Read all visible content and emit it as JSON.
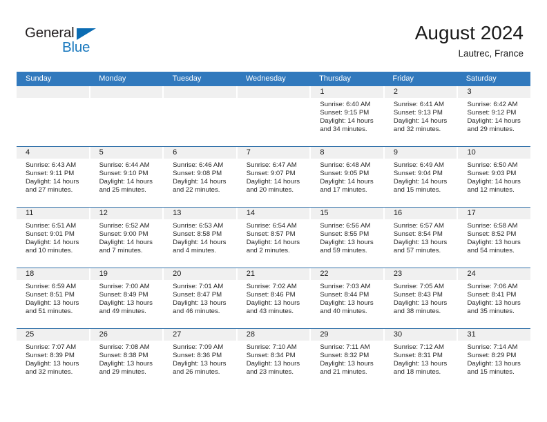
{
  "brand": {
    "name_part1": "General",
    "name_part2": "Blue",
    "triangle_color": "#0b6cb3",
    "blue_color": "#1878be"
  },
  "header": {
    "title": "August 2024",
    "subtitle": "Lautrec, France"
  },
  "theme": {
    "header_blue": "#3179bd",
    "row_divider": "#2f6fa8",
    "day_band": "#f0f0f0",
    "text": "#1a1a1a"
  },
  "weekdays": [
    "Sunday",
    "Monday",
    "Tuesday",
    "Wednesday",
    "Thursday",
    "Friday",
    "Saturday"
  ],
  "weeks": [
    [
      {
        "day": "",
        "sunrise": "",
        "sunset": "",
        "daylight_line1": "",
        "daylight_line2": ""
      },
      {
        "day": "",
        "sunrise": "",
        "sunset": "",
        "daylight_line1": "",
        "daylight_line2": ""
      },
      {
        "day": "",
        "sunrise": "",
        "sunset": "",
        "daylight_line1": "",
        "daylight_line2": ""
      },
      {
        "day": "",
        "sunrise": "",
        "sunset": "",
        "daylight_line1": "",
        "daylight_line2": ""
      },
      {
        "day": "1",
        "sunrise": "Sunrise: 6:40 AM",
        "sunset": "Sunset: 9:15 PM",
        "daylight_line1": "Daylight: 14 hours",
        "daylight_line2": "and 34 minutes."
      },
      {
        "day": "2",
        "sunrise": "Sunrise: 6:41 AM",
        "sunset": "Sunset: 9:13 PM",
        "daylight_line1": "Daylight: 14 hours",
        "daylight_line2": "and 32 minutes."
      },
      {
        "day": "3",
        "sunrise": "Sunrise: 6:42 AM",
        "sunset": "Sunset: 9:12 PM",
        "daylight_line1": "Daylight: 14 hours",
        "daylight_line2": "and 29 minutes."
      }
    ],
    [
      {
        "day": "4",
        "sunrise": "Sunrise: 6:43 AM",
        "sunset": "Sunset: 9:11 PM",
        "daylight_line1": "Daylight: 14 hours",
        "daylight_line2": "and 27 minutes."
      },
      {
        "day": "5",
        "sunrise": "Sunrise: 6:44 AM",
        "sunset": "Sunset: 9:10 PM",
        "daylight_line1": "Daylight: 14 hours",
        "daylight_line2": "and 25 minutes."
      },
      {
        "day": "6",
        "sunrise": "Sunrise: 6:46 AM",
        "sunset": "Sunset: 9:08 PM",
        "daylight_line1": "Daylight: 14 hours",
        "daylight_line2": "and 22 minutes."
      },
      {
        "day": "7",
        "sunrise": "Sunrise: 6:47 AM",
        "sunset": "Sunset: 9:07 PM",
        "daylight_line1": "Daylight: 14 hours",
        "daylight_line2": "and 20 minutes."
      },
      {
        "day": "8",
        "sunrise": "Sunrise: 6:48 AM",
        "sunset": "Sunset: 9:05 PM",
        "daylight_line1": "Daylight: 14 hours",
        "daylight_line2": "and 17 minutes."
      },
      {
        "day": "9",
        "sunrise": "Sunrise: 6:49 AM",
        "sunset": "Sunset: 9:04 PM",
        "daylight_line1": "Daylight: 14 hours",
        "daylight_line2": "and 15 minutes."
      },
      {
        "day": "10",
        "sunrise": "Sunrise: 6:50 AM",
        "sunset": "Sunset: 9:03 PM",
        "daylight_line1": "Daylight: 14 hours",
        "daylight_line2": "and 12 minutes."
      }
    ],
    [
      {
        "day": "11",
        "sunrise": "Sunrise: 6:51 AM",
        "sunset": "Sunset: 9:01 PM",
        "daylight_line1": "Daylight: 14 hours",
        "daylight_line2": "and 10 minutes."
      },
      {
        "day": "12",
        "sunrise": "Sunrise: 6:52 AM",
        "sunset": "Sunset: 9:00 PM",
        "daylight_line1": "Daylight: 14 hours",
        "daylight_line2": "and 7 minutes."
      },
      {
        "day": "13",
        "sunrise": "Sunrise: 6:53 AM",
        "sunset": "Sunset: 8:58 PM",
        "daylight_line1": "Daylight: 14 hours",
        "daylight_line2": "and 4 minutes."
      },
      {
        "day": "14",
        "sunrise": "Sunrise: 6:54 AM",
        "sunset": "Sunset: 8:57 PM",
        "daylight_line1": "Daylight: 14 hours",
        "daylight_line2": "and 2 minutes."
      },
      {
        "day": "15",
        "sunrise": "Sunrise: 6:56 AM",
        "sunset": "Sunset: 8:55 PM",
        "daylight_line1": "Daylight: 13 hours",
        "daylight_line2": "and 59 minutes."
      },
      {
        "day": "16",
        "sunrise": "Sunrise: 6:57 AM",
        "sunset": "Sunset: 8:54 PM",
        "daylight_line1": "Daylight: 13 hours",
        "daylight_line2": "and 57 minutes."
      },
      {
        "day": "17",
        "sunrise": "Sunrise: 6:58 AM",
        "sunset": "Sunset: 8:52 PM",
        "daylight_line1": "Daylight: 13 hours",
        "daylight_line2": "and 54 minutes."
      }
    ],
    [
      {
        "day": "18",
        "sunrise": "Sunrise: 6:59 AM",
        "sunset": "Sunset: 8:51 PM",
        "daylight_line1": "Daylight: 13 hours",
        "daylight_line2": "and 51 minutes."
      },
      {
        "day": "19",
        "sunrise": "Sunrise: 7:00 AM",
        "sunset": "Sunset: 8:49 PM",
        "daylight_line1": "Daylight: 13 hours",
        "daylight_line2": "and 49 minutes."
      },
      {
        "day": "20",
        "sunrise": "Sunrise: 7:01 AM",
        "sunset": "Sunset: 8:47 PM",
        "daylight_line1": "Daylight: 13 hours",
        "daylight_line2": "and 46 minutes."
      },
      {
        "day": "21",
        "sunrise": "Sunrise: 7:02 AM",
        "sunset": "Sunset: 8:46 PM",
        "daylight_line1": "Daylight: 13 hours",
        "daylight_line2": "and 43 minutes."
      },
      {
        "day": "22",
        "sunrise": "Sunrise: 7:03 AM",
        "sunset": "Sunset: 8:44 PM",
        "daylight_line1": "Daylight: 13 hours",
        "daylight_line2": "and 40 minutes."
      },
      {
        "day": "23",
        "sunrise": "Sunrise: 7:05 AM",
        "sunset": "Sunset: 8:43 PM",
        "daylight_line1": "Daylight: 13 hours",
        "daylight_line2": "and 38 minutes."
      },
      {
        "day": "24",
        "sunrise": "Sunrise: 7:06 AM",
        "sunset": "Sunset: 8:41 PM",
        "daylight_line1": "Daylight: 13 hours",
        "daylight_line2": "and 35 minutes."
      }
    ],
    [
      {
        "day": "25",
        "sunrise": "Sunrise: 7:07 AM",
        "sunset": "Sunset: 8:39 PM",
        "daylight_line1": "Daylight: 13 hours",
        "daylight_line2": "and 32 minutes."
      },
      {
        "day": "26",
        "sunrise": "Sunrise: 7:08 AM",
        "sunset": "Sunset: 8:38 PM",
        "daylight_line1": "Daylight: 13 hours",
        "daylight_line2": "and 29 minutes."
      },
      {
        "day": "27",
        "sunrise": "Sunrise: 7:09 AM",
        "sunset": "Sunset: 8:36 PM",
        "daylight_line1": "Daylight: 13 hours",
        "daylight_line2": "and 26 minutes."
      },
      {
        "day": "28",
        "sunrise": "Sunrise: 7:10 AM",
        "sunset": "Sunset: 8:34 PM",
        "daylight_line1": "Daylight: 13 hours",
        "daylight_line2": "and 23 minutes."
      },
      {
        "day": "29",
        "sunrise": "Sunrise: 7:11 AM",
        "sunset": "Sunset: 8:32 PM",
        "daylight_line1": "Daylight: 13 hours",
        "daylight_line2": "and 21 minutes."
      },
      {
        "day": "30",
        "sunrise": "Sunrise: 7:12 AM",
        "sunset": "Sunset: 8:31 PM",
        "daylight_line1": "Daylight: 13 hours",
        "daylight_line2": "and 18 minutes."
      },
      {
        "day": "31",
        "sunrise": "Sunrise: 7:14 AM",
        "sunset": "Sunset: 8:29 PM",
        "daylight_line1": "Daylight: 13 hours",
        "daylight_line2": "and 15 minutes."
      }
    ]
  ]
}
